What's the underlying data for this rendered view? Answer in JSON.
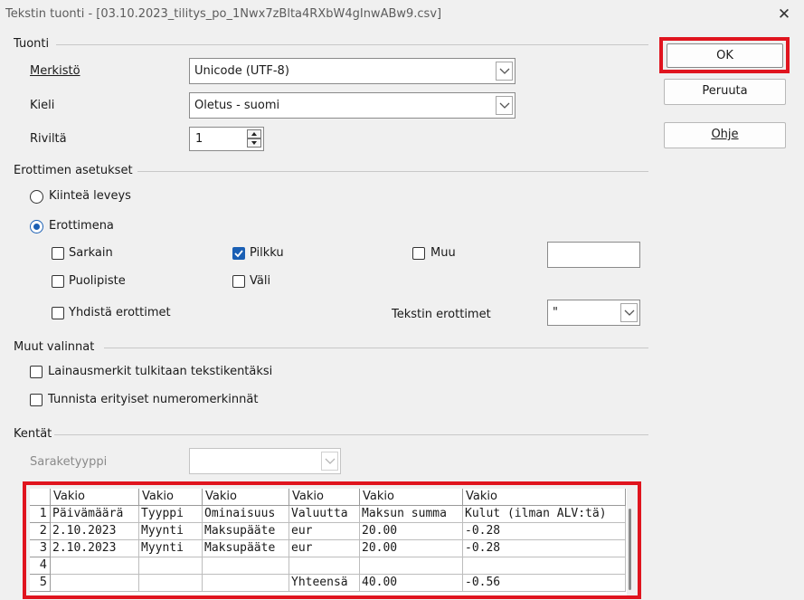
{
  "window": {
    "title": "Tekstin tuonti - [03.10.2023_tilitys_po_1Nwx7zBlta4RXbW4gInwABw9.csv]"
  },
  "buttons": {
    "ok": "OK",
    "cancel": "Peruuta",
    "help": "Ohje"
  },
  "import": {
    "section": "Tuonti",
    "charset_label": "Merkistö",
    "charset_value": "Unicode (UTF-8)",
    "language_label": "Kieli",
    "language_value": "Oletus - suomi",
    "from_row_label": "Riviltä",
    "from_row_value": "1"
  },
  "separator": {
    "section": "Erottimen asetukset",
    "fixed_width": "Kiinteä leveys",
    "separated_by": "Erottimena",
    "tab": "Sarkain",
    "comma": "Pilkku",
    "other": "Muu",
    "semicolon": "Puolipiste",
    "space": "Väli",
    "merge": "Yhdistä erottimet",
    "string_delimiter_label": "Tekstin erottimet",
    "string_delimiter_value": "\"",
    "other_value": "",
    "states": {
      "fixed_width": false,
      "separated_by": true,
      "tab": false,
      "comma": true,
      "other": false,
      "semicolon": false,
      "space": false,
      "merge": false
    }
  },
  "other_options": {
    "section": "Muut valinnat",
    "quoted_as_text": "Lainausmerkit tulkitaan tekstikentäksi",
    "detect_special_numbers": "Tunnista erityiset numeromerkinnät",
    "states": {
      "quoted_as_text": false,
      "detect_special_numbers": false
    }
  },
  "fields": {
    "section": "Kentät",
    "column_type_label": "Saraketyyppi",
    "column_type_value": "",
    "column_types": [
      "Vakio",
      "Vakio",
      "Vakio",
      "Vakio",
      "Vakio",
      "Vakio"
    ],
    "row_numbers": [
      "1",
      "2",
      "3",
      "4",
      "5"
    ],
    "rows": [
      [
        "Päivämäärä",
        "Tyyppi",
        "Ominaisuus",
        "Valuutta",
        "Maksun summa",
        "Kulut (ilman ALV:tä)"
      ],
      [
        "2.10.2023",
        "Myynti",
        "Maksupääte",
        "eur",
        "20.00",
        "-0.28"
      ],
      [
        "2.10.2023",
        "Myynti",
        "Maksupääte",
        "eur",
        "20.00",
        "-0.28"
      ],
      [
        "",
        "",
        "",
        "",
        "",
        ""
      ],
      [
        "",
        "",
        "",
        "Yhteensä",
        "40.00",
        "-0.56"
      ]
    ]
  },
  "colors": {
    "accent": "#1a5fb4",
    "highlight": "#e0141e"
  }
}
